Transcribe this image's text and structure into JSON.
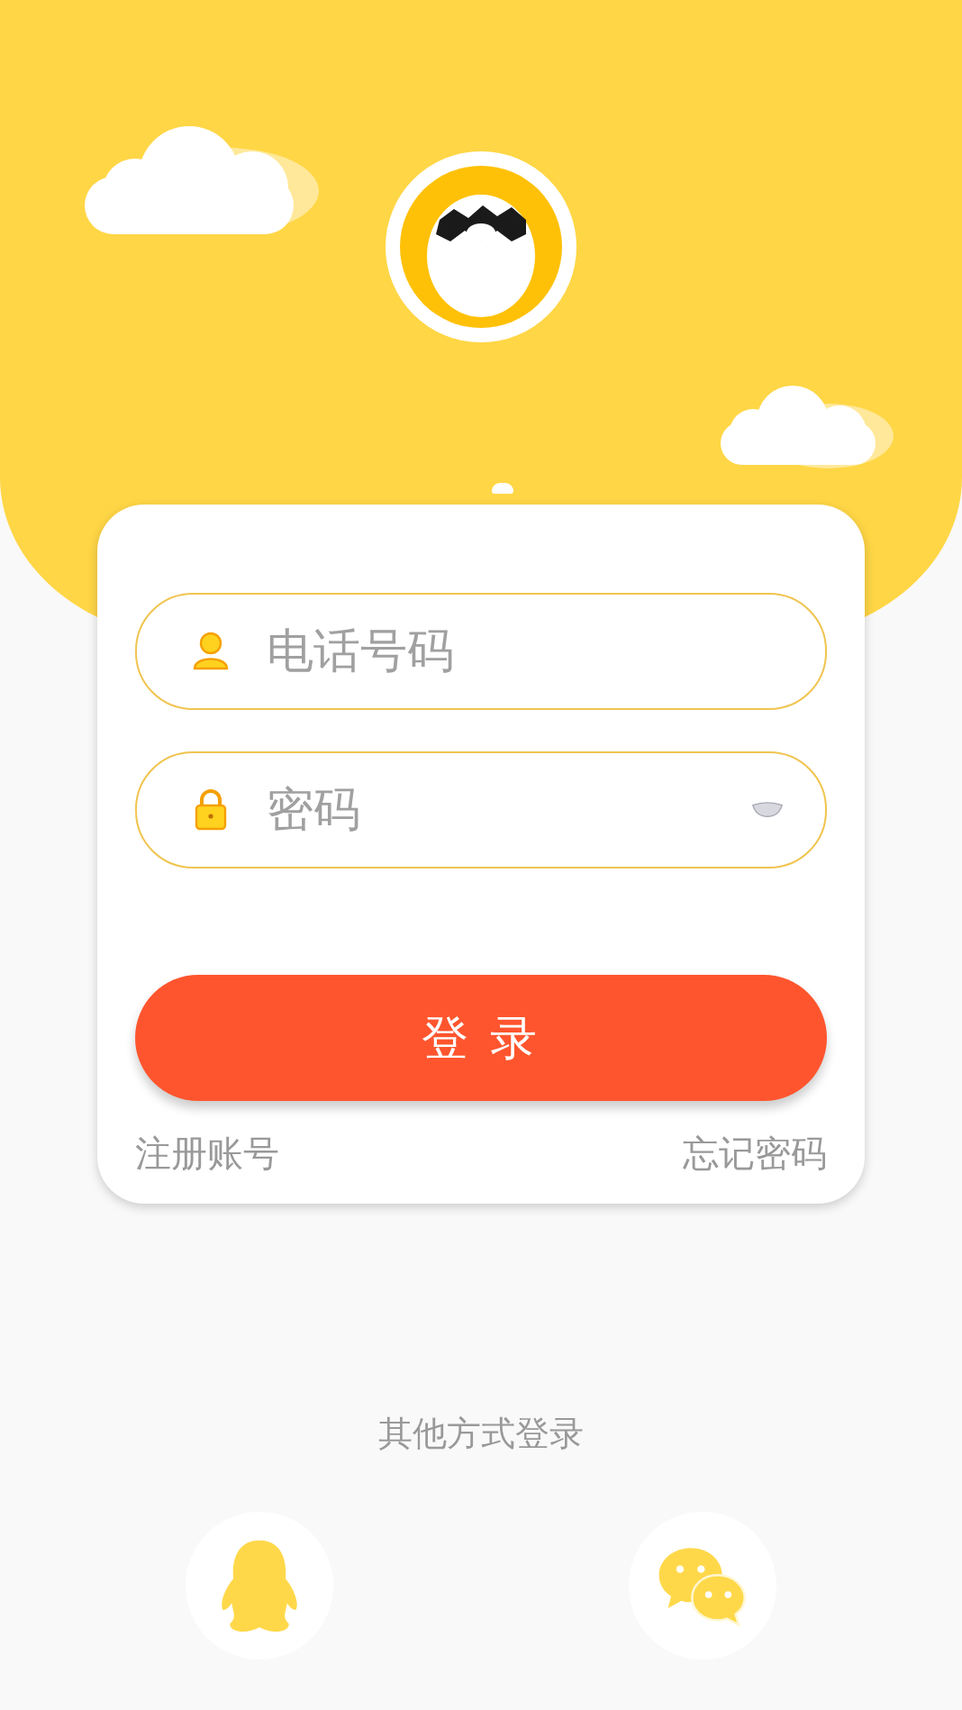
{
  "phone_field": {
    "placeholder": "电话号码"
  },
  "password_field": {
    "placeholder": "密码"
  },
  "login_button": "登 录",
  "register_link": "注册账号",
  "forgot_link": "忘记密码",
  "other_login": {
    "label": "其他方式登录",
    "options": [
      {
        "kind": "penguin"
      },
      {
        "kind": "chat"
      }
    ]
  }
}
